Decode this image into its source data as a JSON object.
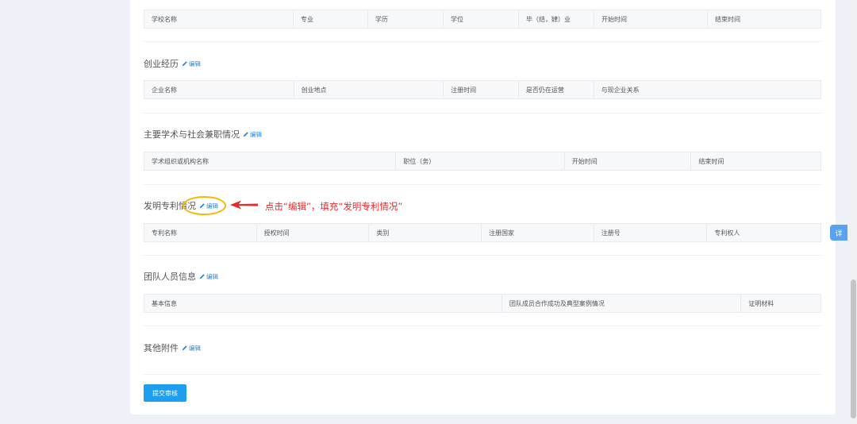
{
  "education": {
    "headers": [
      "学校名称",
      "专业",
      "学历",
      "学位",
      "毕（结，肄）业",
      "开始时间",
      "结束时间"
    ]
  },
  "venture": {
    "title": "创业经历",
    "edit_label": "编辑",
    "headers": [
      "企业名称",
      "创业地点",
      "注册时间",
      "是否仍在运营",
      "与现企业关系"
    ]
  },
  "academic": {
    "title": "主要学术与社会兼职情况",
    "edit_label": "编辑",
    "headers": [
      "学术组织或机构名称",
      "职位（务）",
      "开始时间",
      "结束时间"
    ]
  },
  "patent": {
    "title": "发明专利情况",
    "edit_label": "编辑",
    "headers": [
      "专利名称",
      "授权时间",
      "类别",
      "注册国家",
      "注册号",
      "专利权人"
    ]
  },
  "team": {
    "title": "团队人员信息",
    "edit_label": "编辑",
    "headers": [
      "基本信息",
      "团队成员合作成功及典型案例情况",
      "证明材料"
    ]
  },
  "attachments": {
    "title": "其他附件",
    "edit_label": "编辑"
  },
  "submit_label": "提交审核",
  "annotation": {
    "text": "点击“编辑”，填充“发明专利情况”",
    "color": "#e52b2b",
    "circle_color": "#f5b800"
  },
  "float_button_label": "详",
  "colors": {
    "accent": "#1e88e5",
    "button": "#1e9ef0"
  }
}
